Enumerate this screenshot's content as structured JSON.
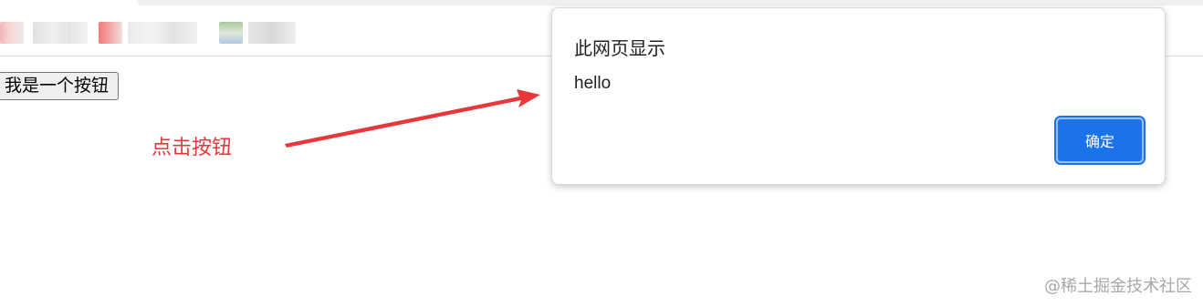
{
  "page": {
    "button_label": "我是一个按钮"
  },
  "annotation": {
    "text": "点击按钮",
    "color": "#e8373a"
  },
  "dialog": {
    "title": "此网页显示",
    "message": "hello",
    "ok_label": "确定",
    "accent_color": "#1a73e8"
  },
  "watermark": {
    "text": "@稀土掘金技术社区"
  }
}
